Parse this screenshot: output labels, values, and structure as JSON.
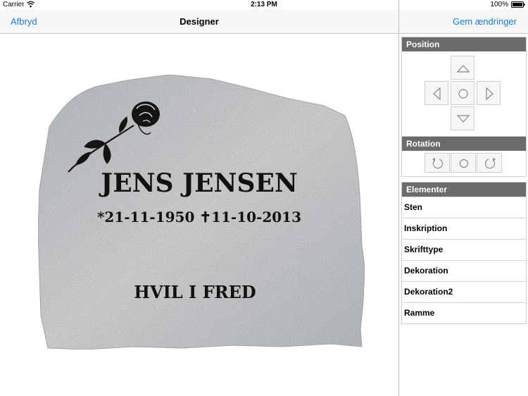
{
  "status_bar": {
    "carrier": "Carrier",
    "time": "2:13 PM",
    "battery": "100%"
  },
  "nav": {
    "cancel_label": "Afbryd",
    "title": "Designer",
    "save_label": "Gem ændringer"
  },
  "stone": {
    "name": "JENS JENSEN",
    "dates": "*21-11-1950 ✝11-10-2013",
    "epitaph": "HVIL I FRED",
    "decoration": "rose-icon"
  },
  "position_panel": {
    "title": "Position"
  },
  "rotation_panel": {
    "title": "Rotation"
  },
  "elements_panel": {
    "title": "Elementer",
    "items": [
      "Sten",
      "Inskription",
      "Skrifttype",
      "Dekoration",
      "Dekoration2",
      "Ramme"
    ]
  },
  "colors": {
    "accent": "#1a7bd4",
    "panel_header": "#6b6b6b",
    "stone_text": "#111111"
  }
}
